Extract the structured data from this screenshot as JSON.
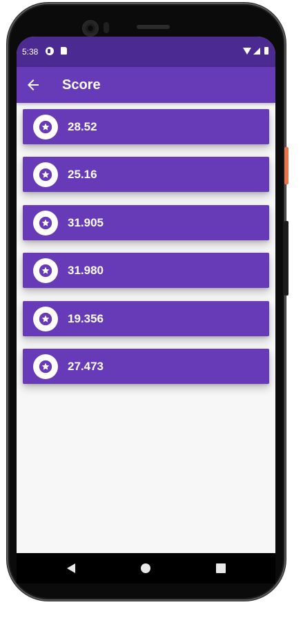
{
  "status_bar": {
    "time": "5:38",
    "icons": [
      "notification-icon",
      "sd-card-icon",
      "wifi-icon",
      "signal-icon",
      "battery-icon"
    ]
  },
  "app_bar": {
    "back_icon": "arrow-back-icon",
    "title": "Score"
  },
  "scores": [
    {
      "value": "28.52",
      "icon": "star-icon"
    },
    {
      "value": "25.16",
      "icon": "star-icon"
    },
    {
      "value": "31.905",
      "icon": "star-icon"
    },
    {
      "value": "31.980",
      "icon": "star-icon"
    },
    {
      "value": "19.356",
      "icon": "star-icon"
    },
    {
      "value": "27.473",
      "icon": "star-icon"
    }
  ],
  "nav_bar": {
    "icons": [
      "nav-back-icon",
      "nav-home-icon",
      "nav-recents-icon"
    ]
  },
  "colors": {
    "primary": "#673ab7",
    "status_bar": "#4b2a91",
    "background": "#f7f7f7",
    "on_primary": "#ffffff"
  }
}
